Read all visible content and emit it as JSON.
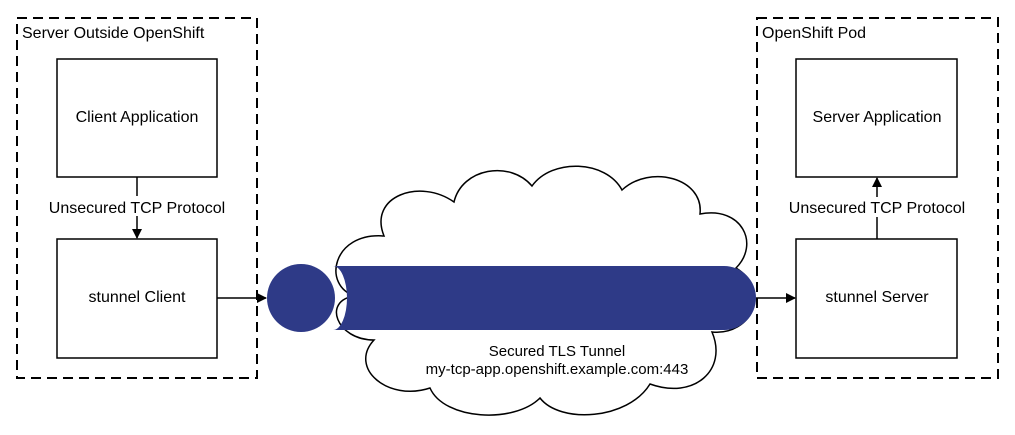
{
  "groups": {
    "left": {
      "title": "Server Outside OpenShift"
    },
    "right": {
      "title": "OpenShift Pod"
    }
  },
  "nodes": {
    "client_app": "Client Application",
    "stunnel_client": "stunnel Client",
    "server_app": "Server Application",
    "stunnel_server": "stunnel Server"
  },
  "edges": {
    "left_protocol": "Unsecured TCP Protocol",
    "right_protocol": "Unsecured TCP Protocol"
  },
  "tunnel": {
    "title": "Secured TLS Tunnel",
    "host": "my-tcp-app.openshift.example.com:443",
    "color": "#2e3a87"
  }
}
